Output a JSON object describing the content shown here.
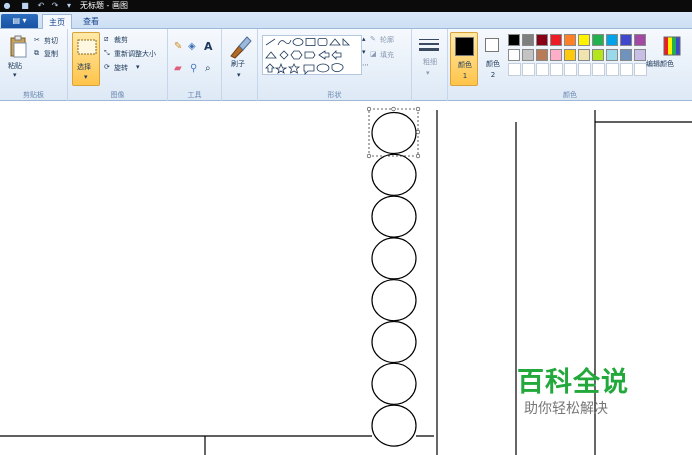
{
  "window": {
    "title": "无标题 - 画图"
  },
  "file_menu": {
    "label": ""
  },
  "tabs": [
    {
      "label": "主页",
      "active": true
    },
    {
      "label": "查看",
      "active": false
    }
  ],
  "ribbon": {
    "clipboard": {
      "group_label": "剪贴板",
      "paste": "粘贴",
      "cut": "剪切",
      "copy": "复制"
    },
    "image": {
      "group_label": "图像",
      "select": "选择",
      "crop": "裁剪",
      "resize": "重新调整大小",
      "rotate": "旋转"
    },
    "tools": {
      "group_label": "工具"
    },
    "brushes": {
      "label": "刷子"
    },
    "shapes": {
      "group_label": "形状",
      "outline": "轮廓",
      "fill": "填充"
    },
    "size": {
      "label": "粗细"
    },
    "colors": {
      "group_label": "颜色",
      "color1_label": "颜色 1",
      "color2_label": "颜色 2",
      "edit_colors": "编辑颜色",
      "color1": "#000000",
      "color2": "#ffffff",
      "palette_row1": [
        "#000000",
        "#7f7f7f",
        "#880015",
        "#ed1c24",
        "#ff7f27",
        "#fff200",
        "#22b14c",
        "#00a2e8",
        "#3f48cc",
        "#a349a4"
      ],
      "palette_row2": [
        "#ffffff",
        "#c3c3c3",
        "#b97a57",
        "#ffaec9",
        "#ffc90e",
        "#efe4b0",
        "#b5e61d",
        "#99d9ea",
        "#7092be",
        "#c8bfe7"
      ]
    }
  },
  "canvas": {
    "circle_count": 8
  },
  "watermark": {
    "main": "百科全说",
    "sub": "助你轻松解决"
  }
}
